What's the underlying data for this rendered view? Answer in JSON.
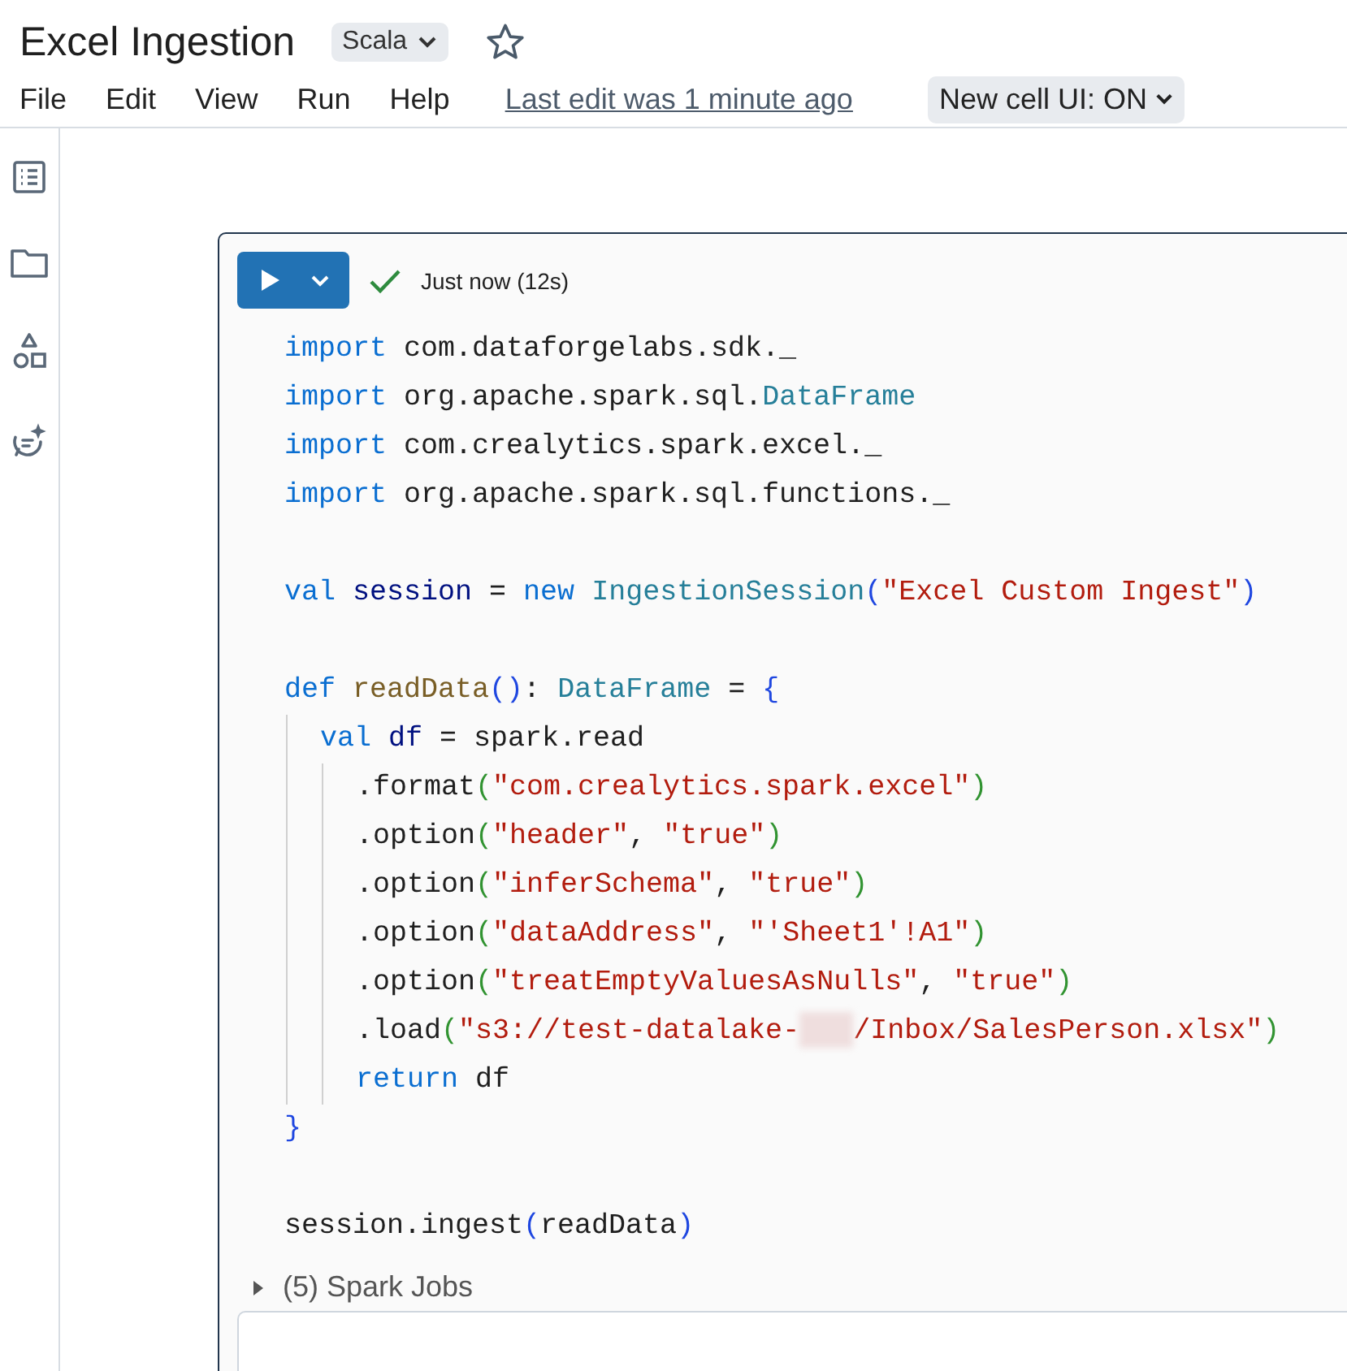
{
  "notebook": {
    "title": "Excel Ingestion",
    "language": "Scala",
    "starred": false
  },
  "menu": [
    {
      "label": "File"
    },
    {
      "label": "Edit"
    },
    {
      "label": "View"
    },
    {
      "label": "Run"
    },
    {
      "label": "Help"
    }
  ],
  "last_edit": "Last edit was 1 minute ago",
  "cell_ui_toggle": "New cell UI: ON",
  "sidebar": [
    {
      "kind": "list"
    },
    {
      "kind": "folder"
    },
    {
      "kind": "shapes"
    },
    {
      "kind": "assistant"
    }
  ],
  "cell": {
    "status": "Just now (12s)",
    "succeeded": true,
    "code": [
      {
        "tokens": [
          {
            "kind": "kw",
            "text": "import"
          },
          {
            "kind": "plain",
            "text": " com.dataforgelabs.sdk._"
          }
        ]
      },
      {
        "tokens": [
          {
            "kind": "kw",
            "text": "import"
          },
          {
            "kind": "plain",
            "text": " org.apache.spark.sql."
          },
          {
            "kind": "type",
            "text": "DataFrame"
          }
        ]
      },
      {
        "tokens": [
          {
            "kind": "kw",
            "text": "import"
          },
          {
            "kind": "plain",
            "text": " com.crealytics.spark.excel._"
          }
        ]
      },
      {
        "tokens": [
          {
            "kind": "kw",
            "text": "import"
          },
          {
            "kind": "plain",
            "text": " org.apache.spark.sql.functions._"
          }
        ]
      },
      {
        "blank_line_before": true,
        "tokens": [
          {
            "kind": "kw",
            "text": "val "
          },
          {
            "kind": "var",
            "text": "session"
          },
          {
            "kind": "plain",
            "text": " = "
          },
          {
            "kind": "kw",
            "text": "new "
          },
          {
            "kind": "type",
            "text": "IngestionSession"
          },
          {
            "kind": "br1",
            "text": "("
          },
          {
            "kind": "str",
            "text": "\"Excel Custom Ingest\""
          },
          {
            "kind": "br1",
            "text": ")"
          }
        ]
      },
      {
        "blank_line_before": true,
        "tokens": [
          {
            "kind": "kw",
            "text": "def "
          },
          {
            "kind": "fn",
            "text": "readData"
          },
          {
            "kind": "br1",
            "text": "()"
          },
          {
            "kind": "plain",
            "text": ": "
          },
          {
            "kind": "type",
            "text": "DataFrame"
          },
          {
            "kind": "plain",
            "text": " = "
          },
          {
            "kind": "br1",
            "text": "{"
          }
        ],
        "children": [
          {
            "tokens": [
              {
                "kind": "kw",
                "text": "val "
              },
              {
                "kind": "var",
                "text": "df"
              },
              {
                "kind": "plain",
                "text": " = spark.read"
              }
            ],
            "children": [
              {
                "tokens": [
                  {
                    "kind": "plain",
                    "text": ".format"
                  },
                  {
                    "kind": "br2",
                    "text": "("
                  },
                  {
                    "kind": "str",
                    "text": "\"com.crealytics.spark.excel\""
                  },
                  {
                    "kind": "br2",
                    "text": ")"
                  }
                ]
              },
              {
                "tokens": [
                  {
                    "kind": "plain",
                    "text": ".option"
                  },
                  {
                    "kind": "br2",
                    "text": "("
                  },
                  {
                    "kind": "str",
                    "text": "\"header\""
                  },
                  {
                    "kind": "plain",
                    "text": ", "
                  },
                  {
                    "kind": "str",
                    "text": "\"true\""
                  },
                  {
                    "kind": "br2",
                    "text": ")"
                  }
                ]
              },
              {
                "tokens": [
                  {
                    "kind": "plain",
                    "text": ".option"
                  },
                  {
                    "kind": "br2",
                    "text": "("
                  },
                  {
                    "kind": "str",
                    "text": "\"inferSchema\""
                  },
                  {
                    "kind": "plain",
                    "text": ", "
                  },
                  {
                    "kind": "str",
                    "text": "\"true\""
                  },
                  {
                    "kind": "br2",
                    "text": ")"
                  }
                ]
              },
              {
                "tokens": [
                  {
                    "kind": "plain",
                    "text": ".option"
                  },
                  {
                    "kind": "br2",
                    "text": "("
                  },
                  {
                    "kind": "str",
                    "text": "\"dataAddress\""
                  },
                  {
                    "kind": "plain",
                    "text": ", "
                  },
                  {
                    "kind": "str",
                    "text": "\"'Sheet1'!A1\""
                  },
                  {
                    "kind": "br2",
                    "text": ")"
                  }
                ]
              },
              {
                "tokens": [
                  {
                    "kind": "plain",
                    "text": ".option"
                  },
                  {
                    "kind": "br2",
                    "text": "("
                  },
                  {
                    "kind": "str",
                    "text": "\"treatEmptyValuesAsNulls\""
                  },
                  {
                    "kind": "plain",
                    "text": ", "
                  },
                  {
                    "kind": "str",
                    "text": "\"true\""
                  },
                  {
                    "kind": "br2",
                    "text": ")"
                  }
                ]
              },
              {
                "tokens": [
                  {
                    "kind": "plain",
                    "text": ".load"
                  },
                  {
                    "kind": "br2",
                    "text": "("
                  },
                  {
                    "kind": "str",
                    "text": "\"s3://test-datalake-"
                  },
                  {
                    "kind": "redacted"
                  },
                  {
                    "kind": "str",
                    "text": "/Inbox/SalesPerson.xlsx\""
                  },
                  {
                    "kind": "br2",
                    "text": ")"
                  }
                ]
              },
              {
                "tokens": [
                  {
                    "kind": "kw",
                    "text": "return"
                  },
                  {
                    "kind": "plain",
                    "text": " df"
                  }
                ]
              }
            ]
          }
        ]
      },
      {
        "tokens": [
          {
            "kind": "br1",
            "text": "}"
          }
        ]
      },
      {
        "blank_line_before": true,
        "tokens": [
          {
            "kind": "plain",
            "text": "session.ingest"
          },
          {
            "kind": "br1",
            "text": "("
          },
          {
            "kind": "plain",
            "text": "readData"
          },
          {
            "kind": "br1",
            "text": ")"
          }
        ]
      }
    ],
    "jobs": {
      "label": "(5) Spark Jobs",
      "expanded": false
    }
  }
}
